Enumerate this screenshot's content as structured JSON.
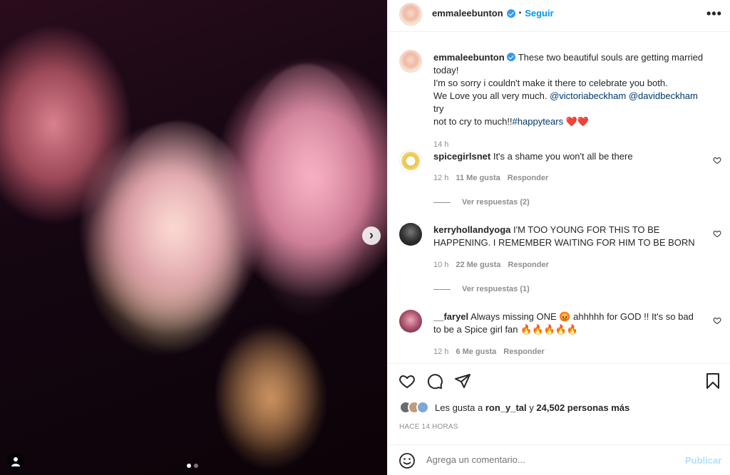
{
  "post": {
    "author": "emmaleebunton",
    "follow_label": "Seguir",
    "more_label": "•••",
    "caption_line1": "These two beautiful souls are getting married",
    "caption_line2": "today!",
    "caption_line3": "I'm so sorry i couldn't make it there to celebrate you both.",
    "caption_line4_prefix": "We Love you all very much.",
    "mention1": "@victoriabeckham",
    "mention2": "@davidbeckham",
    "caption_line4_suffix": "try",
    "caption_line5_prefix": "not to cry to much!!",
    "hashtag": "#happytears",
    "hearts": "❤️❤️",
    "time": "14 h"
  },
  "comments": [
    {
      "user": "spicegirlsnet",
      "text_line1": "It's a shame you won't all be there",
      "text_line2": "",
      "time": "12 h",
      "likes": "11 Me gusta",
      "reply": "Responder",
      "view_replies": "Ver respuestas (2)"
    },
    {
      "user": "kerryhollandyoga",
      "text_line1": "I'M TOO YOUNG FOR THIS TO BE",
      "text_line2": "HAPPENING. I REMEMBER WAITING FOR HIM TO BE BORN",
      "time": "10 h",
      "likes": "22 Me gusta",
      "reply": "Responder",
      "view_replies": "Ver respuestas (1)"
    },
    {
      "user": "__faryel",
      "text_line1": "Always missing ONE 😡 ahhhhh for GOD !! It's so bad",
      "text_line2": "to be a Spice girl fan 🔥🔥🔥🔥🔥",
      "time": "12 h",
      "likes": "6 Me gusta",
      "reply": "Responder"
    }
  ],
  "likes": {
    "prefix": "Les gusta a",
    "user": "ron_y_tal",
    "connector": "y",
    "count": "24,502 personas más"
  },
  "timestamp": "HACE 14 HORAS",
  "comment_box": {
    "placeholder": "Agrega un comentario...",
    "publish": "Publicar"
  },
  "carousel": {
    "next_symbol": "›",
    "slides": 2,
    "current": 1
  },
  "colors": {
    "accent": "#0095f6",
    "verified": "#3897f0",
    "muted": "#8e8e8e",
    "link": "#00376b",
    "like_red": "#ed4956"
  }
}
